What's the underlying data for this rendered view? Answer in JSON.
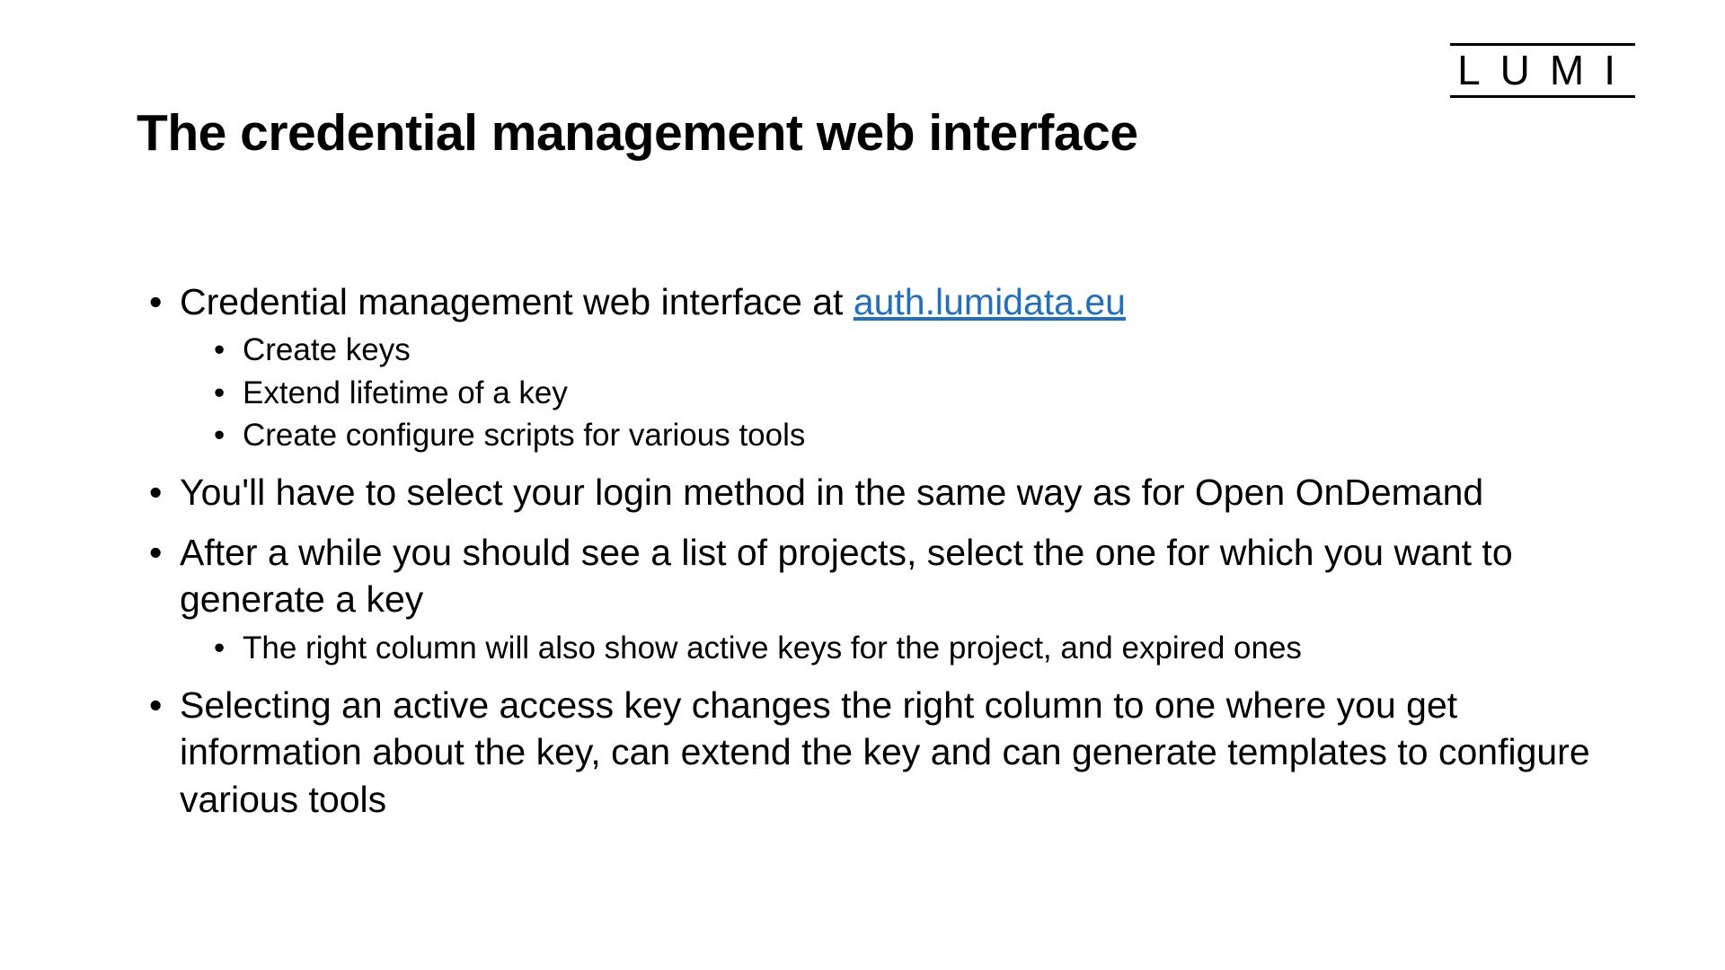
{
  "logo": "LUMI",
  "title": "The credential management web interface",
  "bullets": {
    "b1_prefix": "Credential management web interface at ",
    "b1_link": "auth.lumidata.eu",
    "b1_sub1": "Create keys",
    "b1_sub2": "Extend lifetime of a key",
    "b1_sub3": "Create configure scripts for various tools",
    "b2": "You'll have to select your login method in the same way as for Open OnDemand",
    "b3": "After a while you should see a list of projects, select the one for which you want to generate a key",
    "b3_sub1": "The right column will also show active keys for the project, and expired ones",
    "b4": "Selecting an active access key changes the right column to one where you get information about the key, can extend the key and can generate templates to configure various tools"
  }
}
